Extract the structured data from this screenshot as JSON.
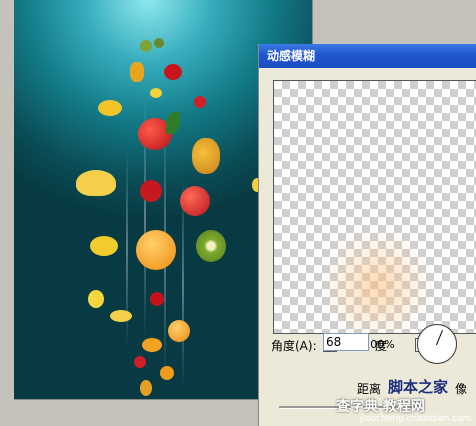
{
  "dialog": {
    "title": "动感模糊",
    "zoom_out_label": "−",
    "zoom_level": "100%",
    "zoom_in_label": "+",
    "angle_label": "角度(A):",
    "angle_value": "68",
    "angle_unit": "度",
    "distance_label": "距离",
    "distance_suffix": "像"
  },
  "watermark": {
    "line1": "脚本之家",
    "line2": "查字典 教程网",
    "url": "jiaocheng.chazidian.com"
  },
  "colors": {
    "titlebar": "#1f56cf",
    "canvas_top": "#8fe7ee",
    "canvas_bottom": "#073a42"
  }
}
